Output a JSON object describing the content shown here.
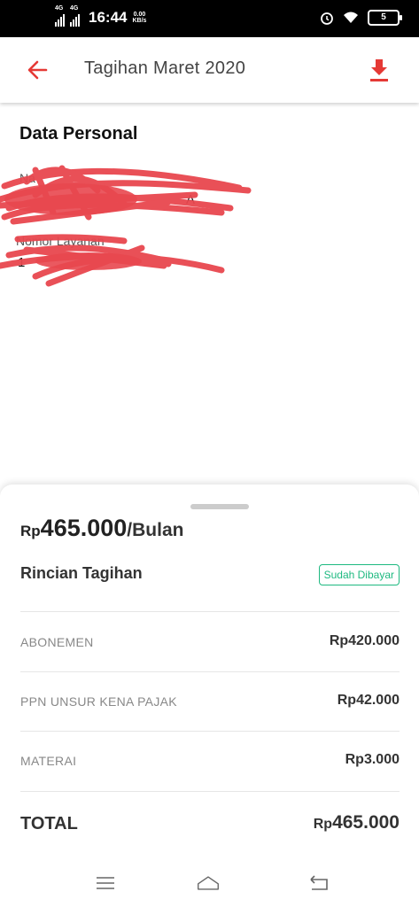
{
  "status_bar": {
    "network1": "4G",
    "network2": "4G",
    "time": "16:44",
    "speed_value": "0.00",
    "speed_unit": "KB/s",
    "battery": "5"
  },
  "header": {
    "title": "Tagihan Maret 2020",
    "back_icon": "arrow-left-icon",
    "download_icon": "download-icon",
    "accent": "#e53935"
  },
  "personal": {
    "section_title": "Data Personal",
    "name_label": "Na",
    "name_value": "A",
    "service_label": "Nomor Layanan",
    "service_value": "1"
  },
  "bill": {
    "currency": "Rp",
    "amount": "465.000",
    "period": "/Bulan",
    "details_title": "Rincian Tagihan",
    "status_badge": "Sudah Dibayar",
    "status_color": "#1eb980",
    "items": [
      {
        "label": "ABONEMEN",
        "value": "Rp420.000"
      },
      {
        "label": "PPN UNSUR KENA PAJAK",
        "value": "Rp42.000"
      },
      {
        "label": "MATERAI",
        "value": "Rp3.000"
      }
    ],
    "total_label": "TOTAL",
    "total_currency": "Rp",
    "total_amount": "465.000"
  },
  "nav_bar": {
    "menu_icon": "menu-icon",
    "home_icon": "home-icon",
    "back_icon": "back-icon"
  }
}
